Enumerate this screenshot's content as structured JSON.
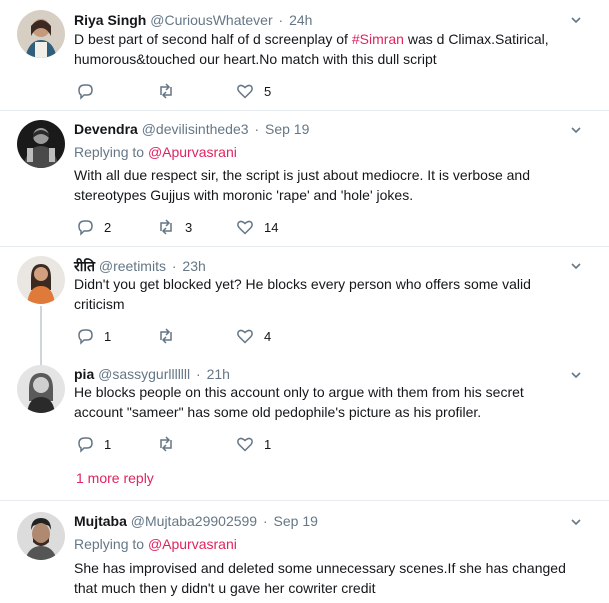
{
  "accent_color": "#e0245e",
  "tweets": [
    {
      "name": "Riya Singh",
      "handle": "@CuriousWhatever",
      "time": "24h",
      "body_prefix": "D best part of second half of d screenplay of ",
      "hashtag": "#Simran",
      "body_suffix": " was d Climax.Satirical, humorous&touched our heart.No match with this dull script",
      "replies": "",
      "retweets": "",
      "likes": "5"
    },
    {
      "name": "Devendra",
      "handle": "@devilisinthede3",
      "time": "Sep 19",
      "replying_prefix": "Replying to ",
      "replying_to": "@Apurvasrani",
      "body": "With all due respect sir, the script is just about mediocre. It is verbose and stereotypes Gujjus with moronic 'rape' and 'hole' jokes.",
      "replies": "2",
      "retweets": "3",
      "likes": "14"
    },
    {
      "name": "रीति",
      "handle": "@reetimits",
      "time": "23h",
      "body": "Didn't you get blocked yet? He blocks every person who offers some valid criticism",
      "replies": "1",
      "retweets": "",
      "likes": "4"
    },
    {
      "name": "pia",
      "handle": "@sassygurlllllll",
      "time": "21h",
      "body": "He blocks people on this account only to argue with them from his secret account \"sameer\" has some old pedophile's picture as his profiler.",
      "replies": "1",
      "retweets": "",
      "likes": "1"
    },
    {
      "name": "Mujtaba",
      "handle": "@Mujtaba29902599",
      "time": "Sep 19",
      "replying_prefix": "Replying to ",
      "replying_to": "@Apurvasrani",
      "body": "She has improvised and deleted some unnecessary scenes.If she has changed that much then y didn't u gave her cowriter credit"
    }
  ],
  "more_reply": "1 more reply",
  "separator": "·"
}
